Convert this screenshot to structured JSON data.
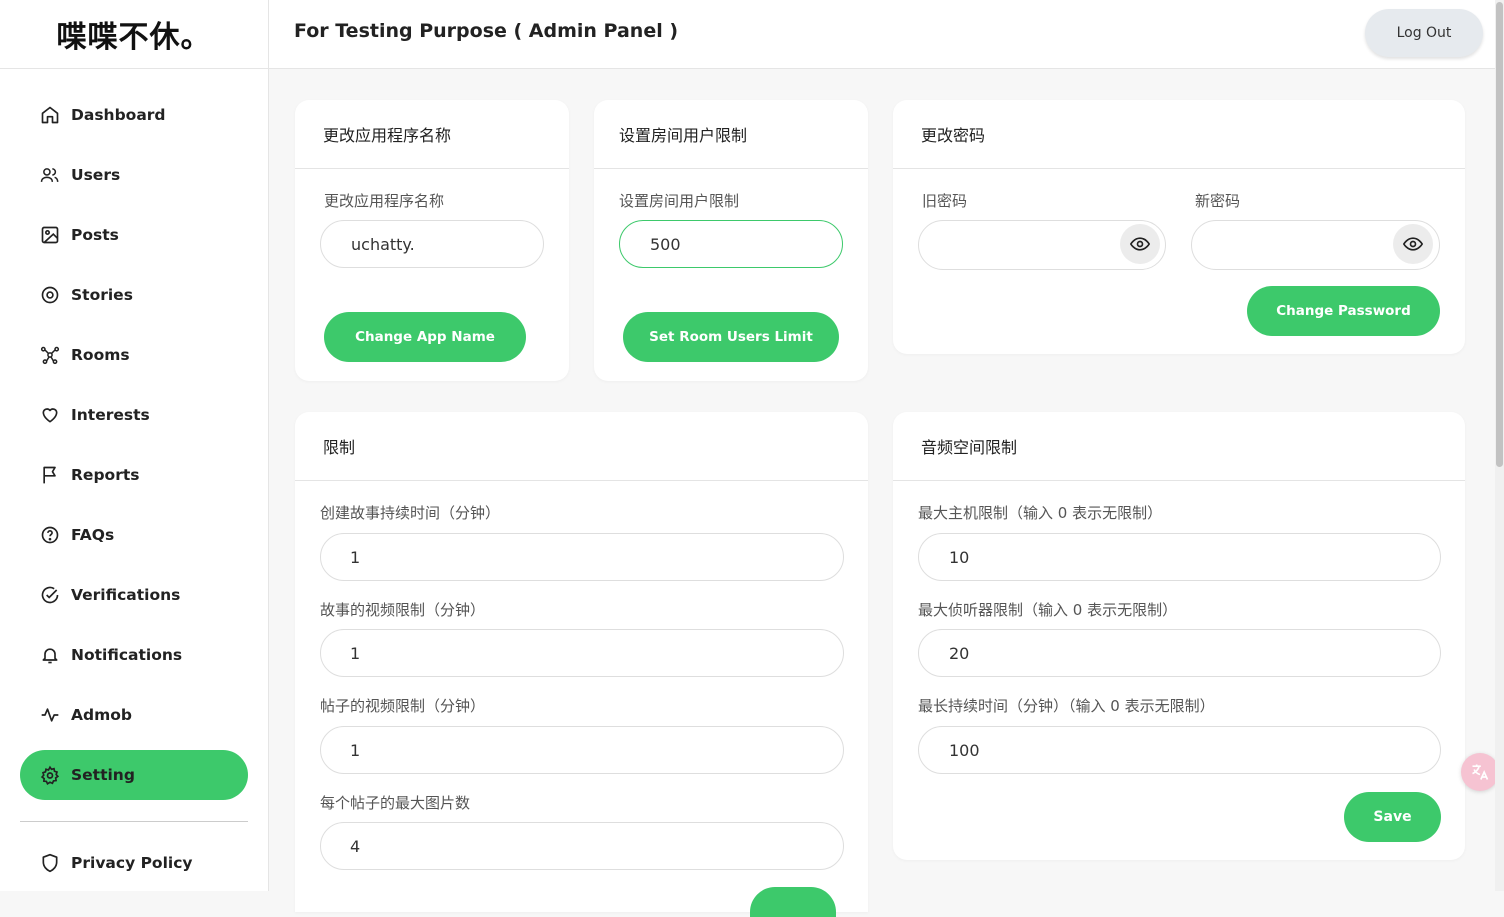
{
  "app": {
    "logo": "喋喋不休。",
    "page_title": "For Testing Purpose ( Admin Panel )",
    "logout_label": "Log Out"
  },
  "colors": {
    "accent": "#3dc96b",
    "background": "#f7f7f7"
  },
  "sidebar": {
    "items": [
      {
        "label": "Dashboard",
        "icon": "home-icon"
      },
      {
        "label": "Users",
        "icon": "users-icon"
      },
      {
        "label": "Posts",
        "icon": "image-icon"
      },
      {
        "label": "Stories",
        "icon": "stories-icon"
      },
      {
        "label": "Rooms",
        "icon": "rooms-icon"
      },
      {
        "label": "Interests",
        "icon": "heart-icon"
      },
      {
        "label": "Reports",
        "icon": "flag-icon"
      },
      {
        "label": "FAQs",
        "icon": "question-icon"
      },
      {
        "label": "Verifications",
        "icon": "check-circle-icon"
      },
      {
        "label": "Notifications",
        "icon": "bell-icon"
      },
      {
        "label": "Admob",
        "icon": "activity-icon"
      },
      {
        "label": "Setting",
        "icon": "gear-icon",
        "active": true
      }
    ],
    "privacy": {
      "label": "Privacy Policy",
      "icon": "shield-icon"
    }
  },
  "app_name_card": {
    "title": "更改应用程序名称",
    "label": "更改应用程序名称",
    "value": "uchatty.",
    "button": "Change App Name"
  },
  "room_limit_card": {
    "title": "设置房间用户限制",
    "label": "设置房间用户限制",
    "value": "500",
    "button": "Set Room Users Limit"
  },
  "password_card": {
    "title": "更改密码",
    "old_label": "旧密码",
    "new_label": "新密码",
    "old_value": "",
    "new_value": "",
    "button": "Change Password"
  },
  "limits_card": {
    "title": "限制",
    "fields": [
      {
        "label": "创建故事持续时间（分钟）",
        "value": "1"
      },
      {
        "label": "故事的视频限制（分钟）",
        "value": "1"
      },
      {
        "label": "帖子的视频限制（分钟）",
        "value": "1"
      },
      {
        "label": "每个帖子的最大图片数",
        "value": "4"
      }
    ]
  },
  "audio_card": {
    "title": "音频空间限制",
    "fields": [
      {
        "label": "最大主机限制（输入 0 表示无限制）",
        "value": "10"
      },
      {
        "label": "最大侦听器限制（输入 0 表示无限制）",
        "value": "20"
      },
      {
        "label": "最长持续时间（分钟）（输入 0 表示无限制）",
        "value": "100"
      }
    ],
    "button": "Save"
  }
}
